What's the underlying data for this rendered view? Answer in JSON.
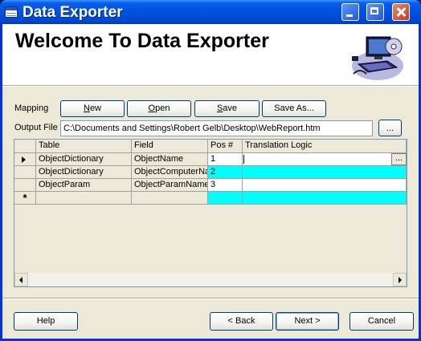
{
  "window": {
    "title": "Data Exporter"
  },
  "header": {
    "title": "Welcome To Data Exporter"
  },
  "mapping": {
    "label": "Mapping",
    "new": {
      "accel": "N",
      "rest": "ew"
    },
    "open": {
      "accel": "O",
      "rest": "pen"
    },
    "save": {
      "accel": "S",
      "rest": "ave"
    },
    "save_as": "Save As..."
  },
  "output": {
    "label": "Output File",
    "value": "C:\\Documents and Settings\\Robert Gelb\\Desktop\\WebReport.htm",
    "browse": "..."
  },
  "grid": {
    "columns": [
      "Table",
      "Field",
      "Pos #",
      "Translation Logic"
    ],
    "rows": [
      {
        "table": "ObjectDictionary",
        "field": "ObjectName",
        "pos": "1",
        "logic": ""
      },
      {
        "table": "ObjectDictionary",
        "field": "ObjectComputerName",
        "pos": "2",
        "logic": ""
      },
      {
        "table": "ObjectParam",
        "field": "ObjectParamName",
        "pos": "3",
        "logic": ""
      }
    ],
    "new_row_marker": "*",
    "cell_button": "..."
  },
  "footer": {
    "help": "Help",
    "back": "< Back",
    "next": "Next >",
    "cancel": "Cancel"
  },
  "colors": {
    "selected_cells": "#00ffff",
    "title_bar": "#0054e3"
  }
}
